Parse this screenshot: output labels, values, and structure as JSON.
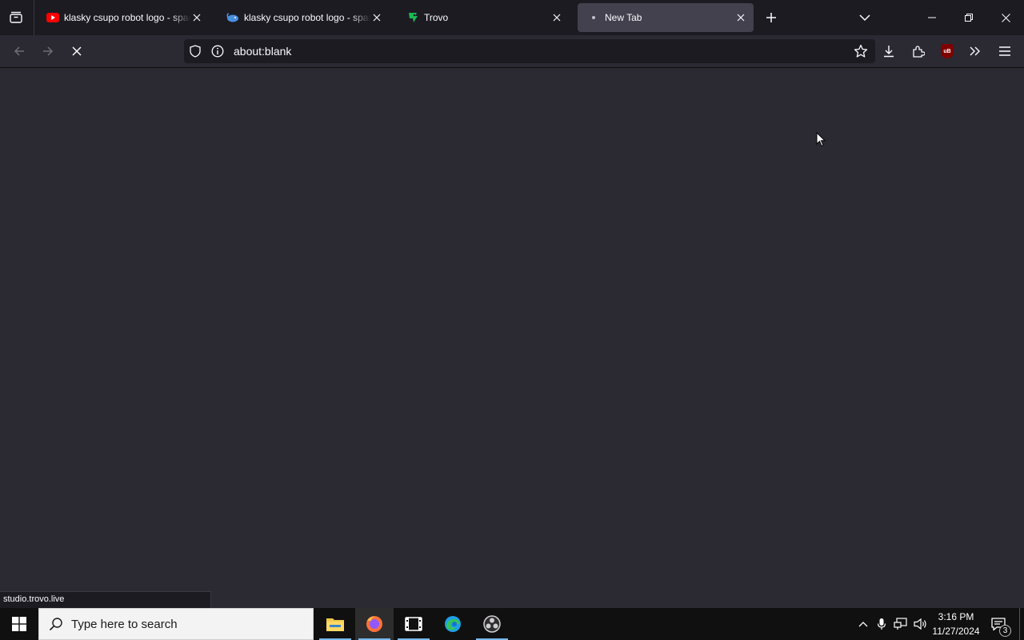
{
  "browser": {
    "tabs": [
      {
        "title": "klasky csupo robot logo - spart",
        "favicon": "youtube-icon",
        "active": false
      },
      {
        "title": "klasky csupo robot logo - spart",
        "favicon": "whale-icon",
        "active": false
      },
      {
        "title": "Trovo",
        "favicon": "trovo-icon",
        "active": false
      },
      {
        "title": "New Tab",
        "favicon": "loading-dot-icon",
        "active": true
      }
    ],
    "address_bar": {
      "url": "about:blank"
    },
    "status_text": "studio.trovo.live",
    "icons": [
      "all-tabs-icon",
      "plus-icon",
      "chevron-down-icon",
      "back-arrow-icon",
      "forward-arrow-icon",
      "stop-icon",
      "shield-icon",
      "info-icon",
      "star-icon",
      "download-icon",
      "extensions-icon",
      "ublock-icon",
      "overflow-icon",
      "hamburger-menu-icon"
    ],
    "ublock_badge": "uB"
  },
  "colors": {
    "content_bg": "#2b2a33",
    "tabstrip_bg": "#1c1b22",
    "active_tab_bg": "#42414d",
    "taskbar_bg": "#101010",
    "youtube_red": "#ff0000",
    "trovo_green": "#1bb954",
    "ublock_red": "#800000"
  },
  "taskbar": {
    "search_placeholder": "Type here to search",
    "apps": [
      "file-explorer-icon",
      "firefox-icon",
      "media-player-icon",
      "edge-icon",
      "obs-icon"
    ],
    "clock": {
      "time": "3:16 PM",
      "date": "11/27/2024"
    },
    "notification_count": "3"
  }
}
